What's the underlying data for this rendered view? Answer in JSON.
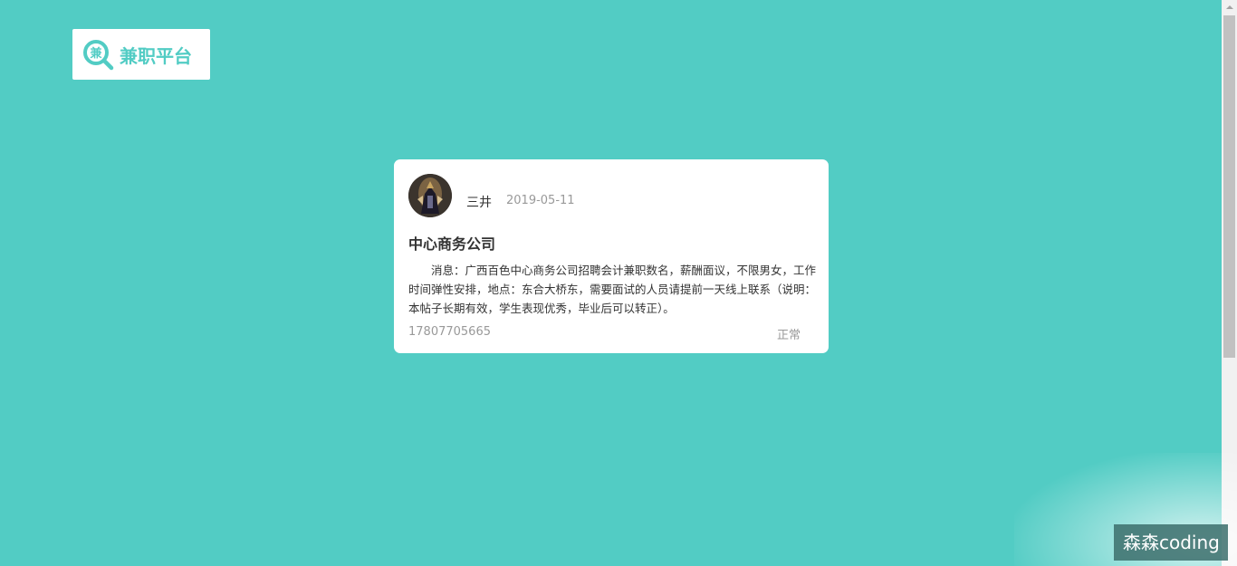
{
  "logo": {
    "icon_char": "兼",
    "text": "兼职平台"
  },
  "post": {
    "username": "三井",
    "date": "2019-05-11",
    "title": "中心商务公司",
    "body": "消息：广西百色中心商务公司招聘会计兼职数名，薪酬面议，不限男女，工作时间弹性安排，地点：东合大桥东，需要面试的人员请提前一天线上联系（说明：本帖子长期有效，学生表现优秀，毕业后可以转正）。",
    "phone": "17807705665",
    "status": "正常"
  },
  "watermark": {
    "text": "森森coding"
  },
  "colors": {
    "background": "#52ccc4",
    "accent": "#52ccc4",
    "card": "#ffffff",
    "muted_text": "#999999",
    "body_text": "#333333"
  },
  "icons": {
    "logo": "search-magnifier-icon",
    "avatar": "user-avatar-image"
  }
}
